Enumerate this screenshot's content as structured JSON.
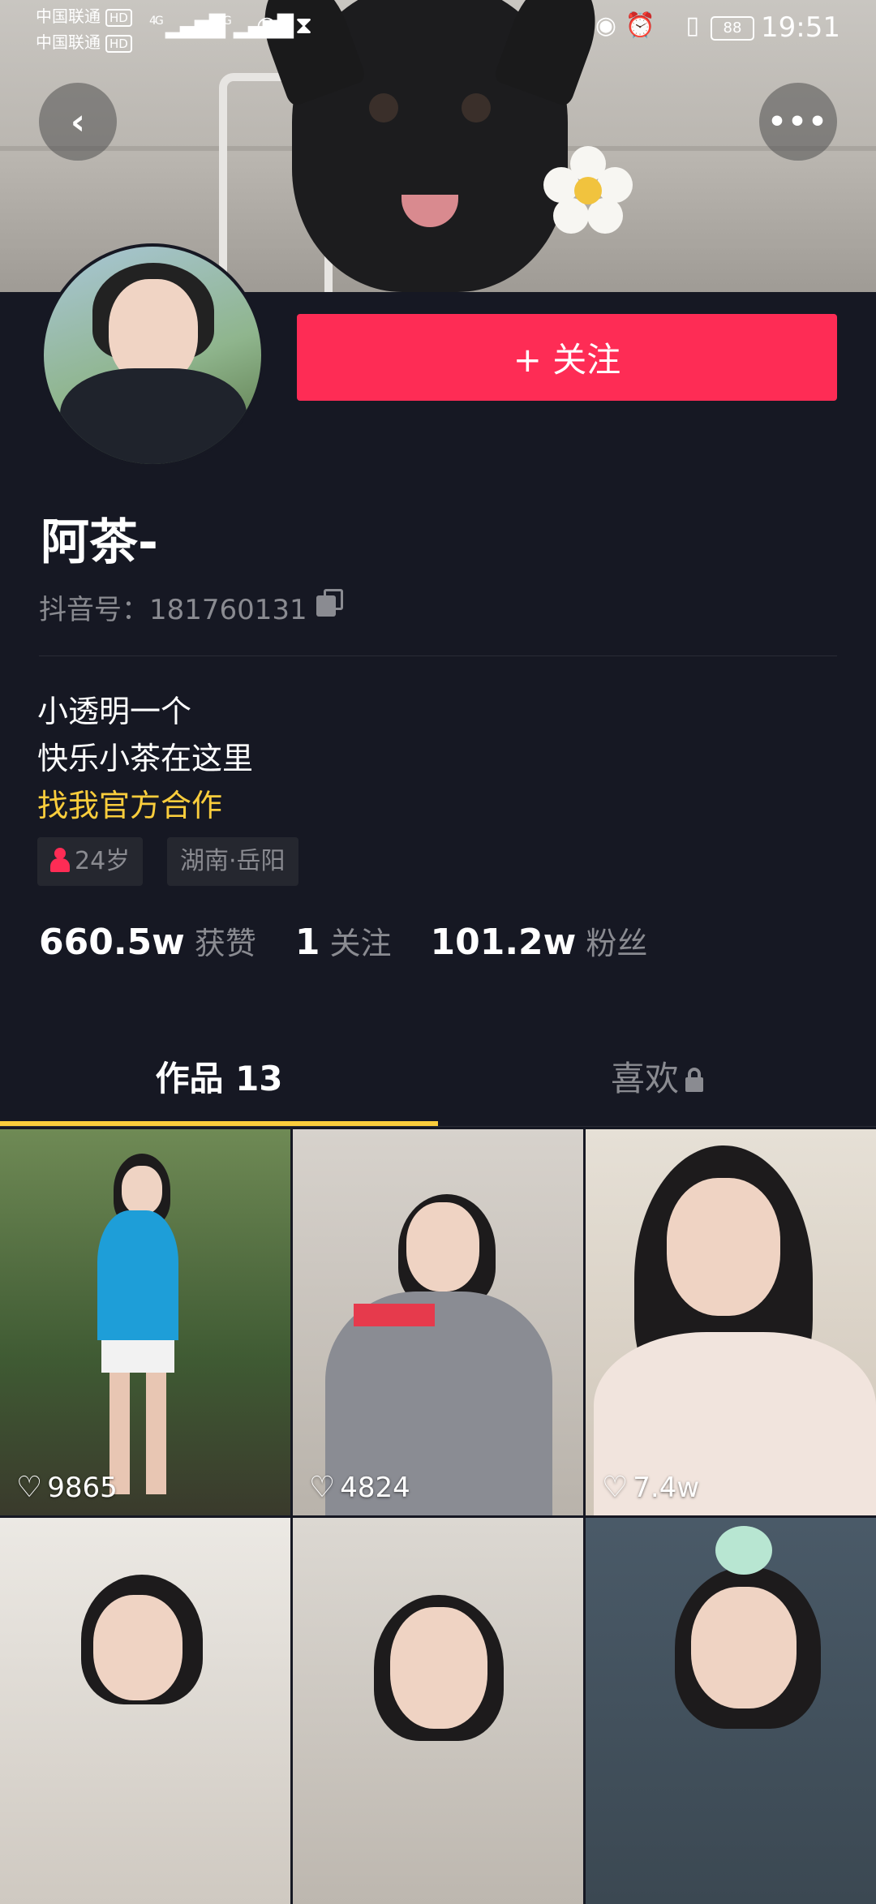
{
  "status_bar": {
    "carrier1": "中国联通",
    "carrier2": "中国联通",
    "hd": "HD",
    "net1": "4G",
    "net2": "4G",
    "battery": "88",
    "time": "19:51"
  },
  "header": {
    "back_icon": "back-arrow",
    "more_icon": "more-dots"
  },
  "profile": {
    "follow_label": "+ 关注",
    "name": "阿茶-",
    "douyin_id": "抖音号：181760131",
    "bio_lines": [
      "小透明一个",
      "快乐小茶在这里"
    ],
    "bio_link": "找我官方合作",
    "tag_age": "24岁",
    "tag_location": "湖南·岳阳"
  },
  "stats": {
    "likes_num": "660.5w",
    "likes_label": "获赞",
    "following_num": "1",
    "following_label": "关注",
    "fans_num": "101.2w",
    "fans_label": "粉丝"
  },
  "tabs": {
    "works": "作品 13",
    "likes": "喜欢"
  },
  "videos": [
    {
      "likes": "9865"
    },
    {
      "likes": "4824"
    },
    {
      "likes": "7.4w"
    },
    {
      "likes": ""
    },
    {
      "likes": ""
    },
    {
      "likes": ""
    }
  ],
  "colors": {
    "background": "#161823",
    "follow_button": "#fe2c55",
    "accent_yellow": "#facd3c",
    "secondary_text": "#8a8b91"
  }
}
